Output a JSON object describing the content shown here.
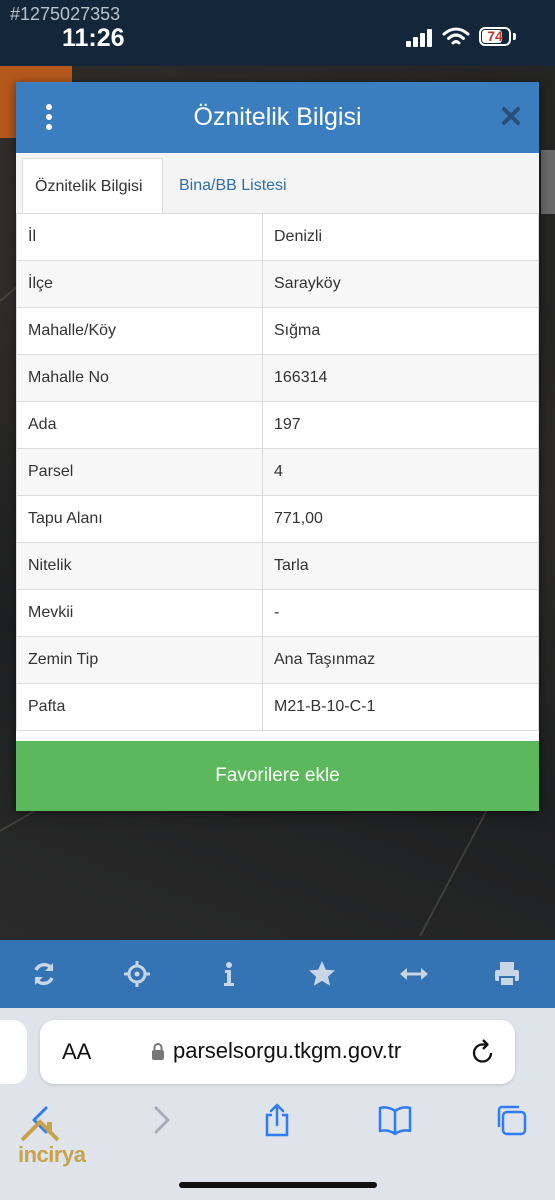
{
  "status_bar": {
    "listing_id": "#1275027353",
    "time": "11:26",
    "battery_level": "74"
  },
  "modal": {
    "title": "Öznitelik Bilgisi",
    "tabs": [
      {
        "label": "Öznitelik Bilgisi",
        "active": true
      },
      {
        "label": "Bina/BB Listesi",
        "active": false
      }
    ],
    "rows": [
      {
        "label": "İl",
        "value": "Denizli"
      },
      {
        "label": "İlçe",
        "value": "Sarayköy"
      },
      {
        "label": "Mahalle/Köy",
        "value": "Sığma"
      },
      {
        "label": "Mahalle No",
        "value": "166314"
      },
      {
        "label": "Ada",
        "value": "197"
      },
      {
        "label": "Parsel",
        "value": "4"
      },
      {
        "label": "Tapu Alanı",
        "value": "771,00"
      },
      {
        "label": "Nitelik",
        "value": "Tarla"
      },
      {
        "label": "Mevkii",
        "value": "-"
      },
      {
        "label": "Zemin Tip",
        "value": "Ana Taşınmaz"
      },
      {
        "label": "Pafta",
        "value": "M21-B-10-C-1"
      }
    ],
    "favorite_button": "Favorilere ekle"
  },
  "map_toolbar": {
    "icons": [
      "refresh-icon",
      "locate-icon",
      "info-icon",
      "star-icon",
      "measure-icon",
      "print-icon"
    ]
  },
  "browser": {
    "aa_label": "AA",
    "url": "parselsorgu.tkgm.gov.tr",
    "nav_icons": [
      "back-icon",
      "forward-icon",
      "share-icon",
      "bookmarks-icon",
      "tabs-icon"
    ]
  },
  "watermark": {
    "text": "incirya"
  },
  "colors": {
    "header": "#3a7ebf",
    "favorite": "#5cb85c",
    "toolbar": "#3473b4",
    "link": "#2c6fa8",
    "ios_blue": "#2f7cf6"
  }
}
